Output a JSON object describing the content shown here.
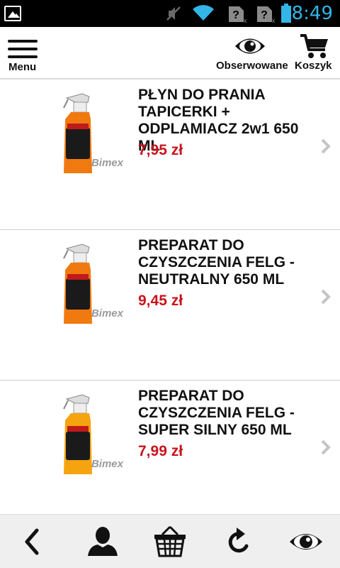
{
  "status_bar": {
    "time": "8:49",
    "icons": [
      "image-notification-icon",
      "mute-icon",
      "wifi-icon",
      "no-sim-icon",
      "no-sim-icon",
      "battery-icon"
    ]
  },
  "header": {
    "menu_label": "Menu",
    "watch_label": "Obserwowane",
    "cart_label": "Koszyk"
  },
  "products": [
    {
      "name": "PŁYN DO PRANIA TAPICERKI + ODPLAMIACZ 2w1 650 ML",
      "price": "7,95 zł",
      "brand_watermark": "Bimex"
    },
    {
      "name": "PREPARAT DO CZYSZCZENIA FELG - NEUTRALNY 650 ML",
      "price": "9,45 zł",
      "brand_watermark": "Bimex"
    },
    {
      "name": "PREPARAT DO CZYSZCZENIA FELG - SUPER SILNY 650 ML",
      "price": "7,99 zł",
      "brand_watermark": "Bimex"
    }
  ],
  "bottom_bar": {
    "icons": [
      "back-icon",
      "account-icon",
      "basket-icon",
      "refresh-icon",
      "watched-icon"
    ]
  },
  "colors": {
    "price": "#c8141c",
    "status_accent": "#33b5e5",
    "bottle_orange": "#f07a10",
    "bottle_amber": "#f5a40f"
  }
}
